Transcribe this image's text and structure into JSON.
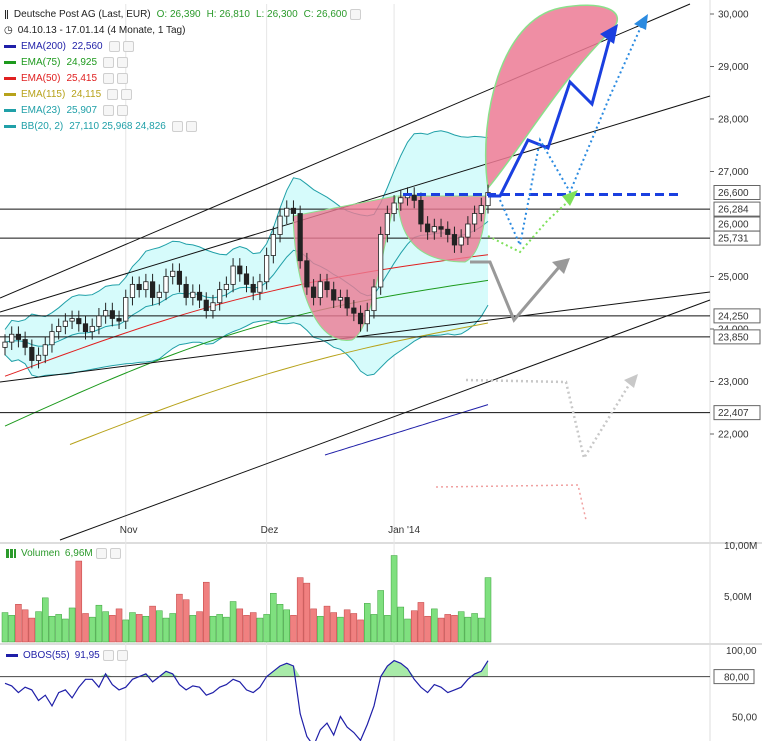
{
  "header": {
    "title": "Deutsche Post AG (Last, EUR)",
    "open": "O: 26,390",
    "high": "H: 26,810",
    "low": "L: 26,300",
    "close": "C: 26,600",
    "period": "04.10.13 - 17.01.14 (4 Monate, 1 Tag)"
  },
  "indicators": [
    {
      "label": "EMA(200)",
      "value": "22,560",
      "color": "#1f1fa8"
    },
    {
      "label": "EMA(75)",
      "value": "24,925",
      "color": "#1d9a1d"
    },
    {
      "label": "EMA(50)",
      "value": "25,415",
      "color": "#e02020"
    },
    {
      "label": "EMA(115)",
      "value": "24,115",
      "color": "#b7a21a"
    },
    {
      "label": "EMA(23)",
      "value": "25,907",
      "color": "#20a0a8"
    },
    {
      "label": "BB(20, 2)",
      "value": "27,110  25,968  24,826",
      "color": "#20a0a8"
    }
  ],
  "volume_panel": {
    "label": "Volumen",
    "value": "6,96M"
  },
  "obos_panel": {
    "label": "OBOS(55)",
    "value": "91,95"
  },
  "price_axis": [
    "30,000",
    "29,000",
    "28,000",
    "27,000",
    "25,000",
    "24,000",
    "23,000",
    "22,000"
  ],
  "price_tags": [
    {
      "text": "26,600",
      "v": 26.6
    },
    {
      "text": "26,284",
      "v": 26.284
    },
    {
      "text": "26,000",
      "v": 26.0
    },
    {
      "text": "25,731",
      "v": 25.731
    },
    {
      "text": "24,250",
      "v": 24.25
    },
    {
      "text": "23,850",
      "v": 23.85
    },
    {
      "text": "22,407",
      "v": 22.407
    }
  ],
  "volume_axis": [
    "10,00M",
    "5,00M"
  ],
  "obos_axis": [
    "100,00",
    "50,00"
  ],
  "obos_tag": "80,00",
  "x_labels": [
    "Nov",
    "Dez",
    "Jan '14"
  ],
  "colors": {
    "up": "#7fe07f",
    "down": "#f08080",
    "band": "#d6fbfb",
    "cup": "#ec7a94",
    "arrow_blue": "#1a3fe0"
  },
  "chart_data": {
    "type": "candlestick",
    "title": "Deutsche Post AG (Last, EUR)",
    "ylim": [
      21.5,
      30.2
    ],
    "x_ticks": [
      {
        "label": "Nov",
        "i": 18
      },
      {
        "label": "Dez",
        "i": 39
      },
      {
        "label": "Jan '14",
        "i": 58
      }
    ],
    "close": [
      23.75,
      23.9,
      23.8,
      23.65,
      23.4,
      23.5,
      23.7,
      23.95,
      24.05,
      24.15,
      24.2,
      24.1,
      23.95,
      24.05,
      24.25,
      24.35,
      24.2,
      24.15,
      24.6,
      24.85,
      24.75,
      24.9,
      24.6,
      24.7,
      25.0,
      25.1,
      24.85,
      24.6,
      24.7,
      24.55,
      24.35,
      24.5,
      24.75,
      24.85,
      25.2,
      25.05,
      24.85,
      24.7,
      24.9,
      25.4,
      25.8,
      26.15,
      26.3,
      26.2,
      25.3,
      24.8,
      24.6,
      24.9,
      24.75,
      24.55,
      24.6,
      24.4,
      24.3,
      24.1,
      24.35,
      24.8,
      25.8,
      26.2,
      26.4,
      26.5,
      26.55,
      26.45,
      26.0,
      25.85,
      25.95,
      25.9,
      25.8,
      25.6,
      25.75,
      26.0,
      26.2,
      26.35,
      26.6
    ],
    "volume_m": [
      3.2,
      2.9,
      4.1,
      3.5,
      2.6,
      3.3,
      4.8,
      2.8,
      3.0,
      2.5,
      3.7,
      8.8,
      3.1,
      2.7,
      4.0,
      3.3,
      2.9,
      3.6,
      2.4,
      3.2,
      3.0,
      2.8,
      3.9,
      3.4,
      2.6,
      3.1,
      5.2,
      4.6,
      2.9,
      3.3,
      6.5,
      2.8,
      3.0,
      2.7,
      4.4,
      3.6,
      2.9,
      3.2,
      2.6,
      3.0,
      5.3,
      4.1,
      3.5,
      2.9,
      7.0,
      6.4,
      3.6,
      2.8,
      3.9,
      3.2,
      2.7,
      3.5,
      3.1,
      2.4,
      4.2,
      3.0,
      5.6,
      2.9,
      9.4,
      3.8,
      2.5,
      3.4,
      4.3,
      2.8,
      3.6,
      2.6,
      3.0,
      2.9,
      3.3,
      2.7,
      3.1,
      2.6,
      7.0
    ],
    "volume_ylim": [
      0,
      10
    ],
    "obos": [
      75,
      73,
      68,
      72,
      70,
      62,
      66,
      58,
      68,
      70,
      64,
      72,
      78,
      78,
      72,
      82,
      74,
      70,
      72,
      78,
      80,
      82,
      76,
      80,
      84,
      82,
      74,
      70,
      73,
      72,
      66,
      68,
      72,
      74,
      78,
      76,
      70,
      68,
      72,
      80,
      84,
      88,
      90,
      88,
      52,
      35,
      28,
      40,
      45,
      36,
      50,
      42,
      38,
      32,
      44,
      58,
      80,
      88,
      92,
      90,
      86,
      78,
      72,
      68,
      74,
      72,
      68,
      70,
      72,
      78,
      82,
      84,
      91.95
    ],
    "obos_ylim": [
      40,
      105
    ]
  }
}
